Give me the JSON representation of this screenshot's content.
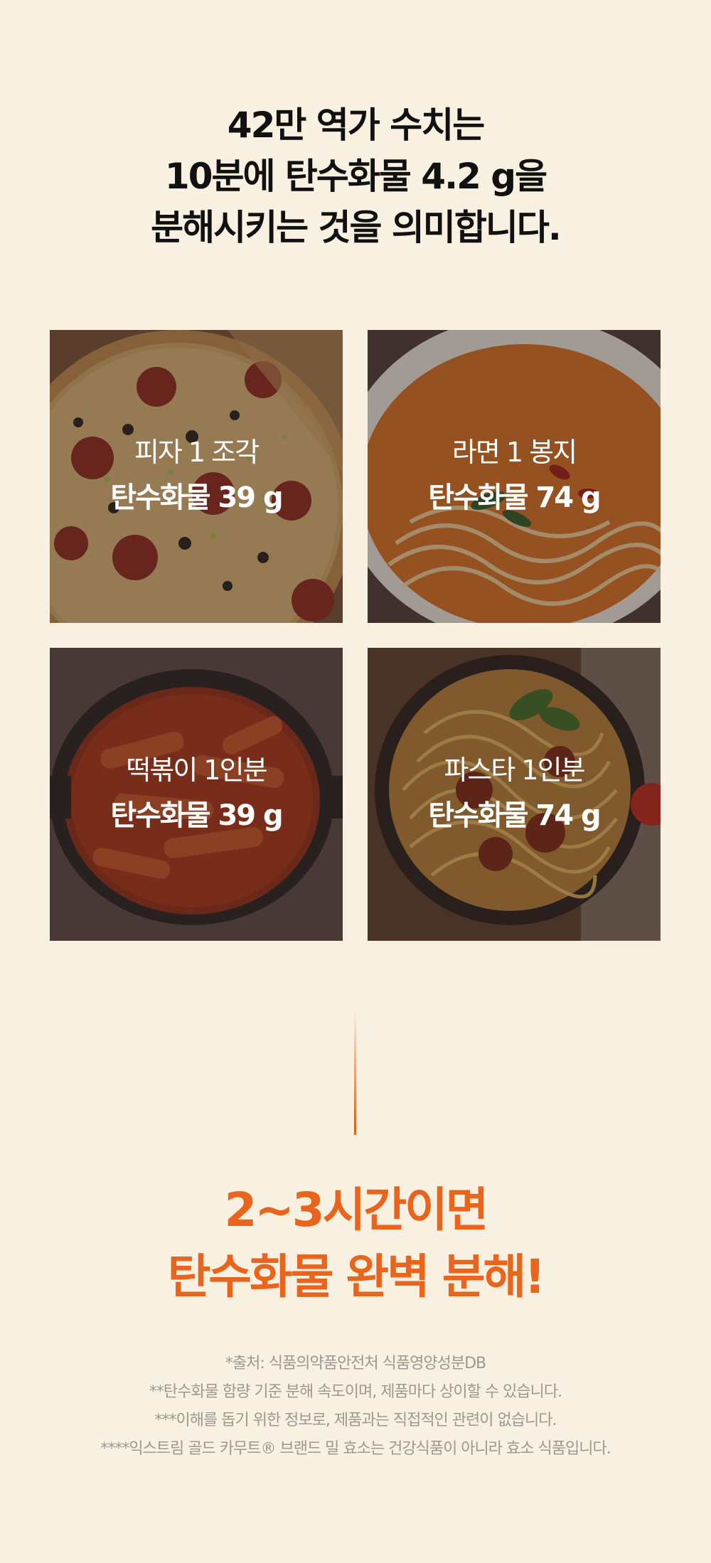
{
  "headline": {
    "line1": "42만 역가 수치는",
    "line2": "10분에 탄수화물 4.2 g을",
    "line3": "분해시키는 것을 의미합니다."
  },
  "foods": [
    {
      "name": "피자 1 조각",
      "carbs": "탄수화물 39 g"
    },
    {
      "name": "라면 1 봉지",
      "carbs": "탄수화물 74 g"
    },
    {
      "name": "떡볶이 1인분",
      "carbs": "탄수화물 39 g"
    },
    {
      "name": "파스타 1인분",
      "carbs": "탄수화물 74 g"
    }
  ],
  "result": {
    "line1": "2~3시간이면",
    "line2": "탄수화물 완벽 분해!"
  },
  "notes": [
    "*출처: 식품의약품안전처 식품영양성분DB",
    "**탄수화물 함량 기준 분해 속도이며, 제품마다 상이할 수 있습니다.",
    "***이해를 돕기 위한 정보로, 제품과는 직접적인 관련이 없습니다.",
    "****익스트림 골드 카무트® 브랜드 밀 효소는 건강식품이 아니라 효소 식품입니다."
  ],
  "colors": {
    "background": "#f8f0e1",
    "accent": "#e9651d",
    "note_text": "#9c9893"
  }
}
